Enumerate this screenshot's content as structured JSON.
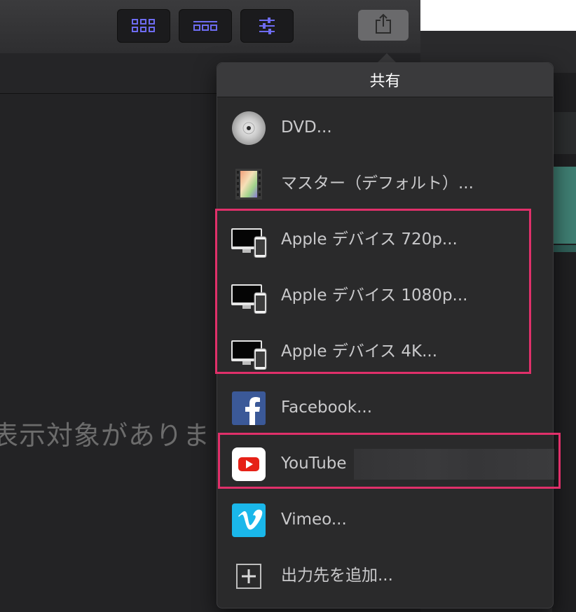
{
  "toolbar": {
    "buttons": [
      {
        "icon": "browser-grid-icon"
      },
      {
        "icon": "timeline-icon"
      },
      {
        "icon": "inspector-sliders-icon"
      }
    ],
    "share_icon": "share-icon"
  },
  "viewer": {
    "empty_message": "表示対象がありま"
  },
  "share_menu": {
    "title": "共有",
    "items": [
      {
        "label": "DVD...",
        "icon": "dvd-disc-icon"
      },
      {
        "label": "マスター（デフォルト）...",
        "icon": "film-strip-icon"
      },
      {
        "label": "Apple デバイス 720p...",
        "icon": "apple-devices-icon"
      },
      {
        "label": "Apple デバイス 1080p...",
        "icon": "apple-devices-icon"
      },
      {
        "label": "Apple デバイス 4K...",
        "icon": "apple-devices-icon"
      },
      {
        "label": "Facebook...",
        "icon": "facebook-icon"
      },
      {
        "label": "YouTube",
        "icon": "youtube-icon"
      },
      {
        "label": "Vimeo...",
        "icon": "vimeo-icon"
      },
      {
        "label": "出力先を追加...",
        "icon": "add-destination-icon"
      }
    ]
  },
  "colors": {
    "highlight": "#e0306a",
    "accent_button": "#5856d6",
    "facebook": "#3b5998",
    "youtube": "#e62117",
    "vimeo": "#1ab7ea"
  }
}
